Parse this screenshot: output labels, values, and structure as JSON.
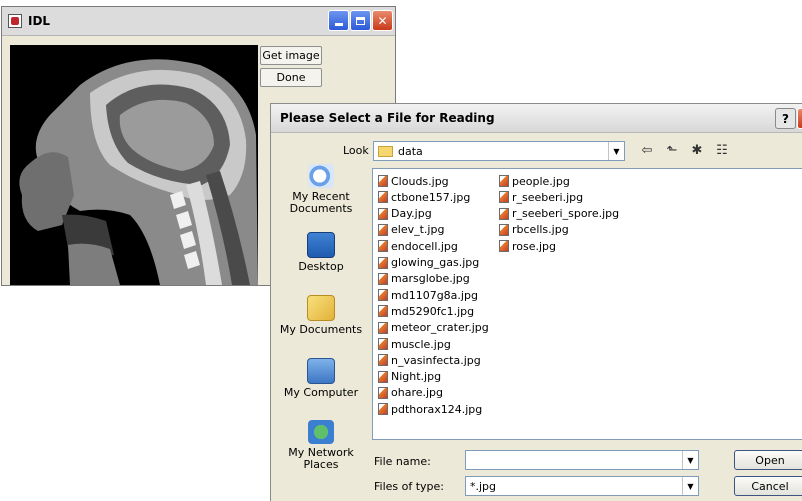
{
  "idl_window": {
    "title": "IDL",
    "get_image_label": "Get image",
    "done_label": "Done",
    "image_description_icon": "mri-sagittal-head-neck"
  },
  "dialog": {
    "title": "Please Select a File for Reading",
    "help_label": "?",
    "look_in_label": "Look in:",
    "look_in_value": "data",
    "places": [
      {
        "label": "My Recent Documents",
        "icon": "recent-documents-icon"
      },
      {
        "label": "Desktop",
        "icon": "desktop-icon"
      },
      {
        "label": "My Documents",
        "icon": "my-documents-icon"
      },
      {
        "label": "My Computer",
        "icon": "my-computer-icon"
      },
      {
        "label": "My Network Places",
        "icon": "network-places-icon"
      }
    ],
    "files_col1": [
      "Clouds.jpg",
      "ctbone157.jpg",
      "Day.jpg",
      "elev_t.jpg",
      "endocell.jpg",
      "glowing_gas.jpg",
      "marsglobe.jpg",
      "md1107g8a.jpg",
      "md5290fc1.jpg",
      "meteor_crater.jpg",
      "muscle.jpg",
      "n_vasinfecta.jpg",
      "Night.jpg",
      "ohare.jpg",
      "pdthorax124.jpg"
    ],
    "files_col2": [
      "people.jpg",
      "r_seeberi.jpg",
      "r_seeberi_spore.jpg",
      "rbcells.jpg",
      "rose.jpg"
    ],
    "file_name_label": "File name:",
    "file_name_value": "",
    "files_of_type_label": "Files of type:",
    "files_of_type_value": "*.jpg",
    "open_label": "Open",
    "cancel_label": "Cancel"
  }
}
